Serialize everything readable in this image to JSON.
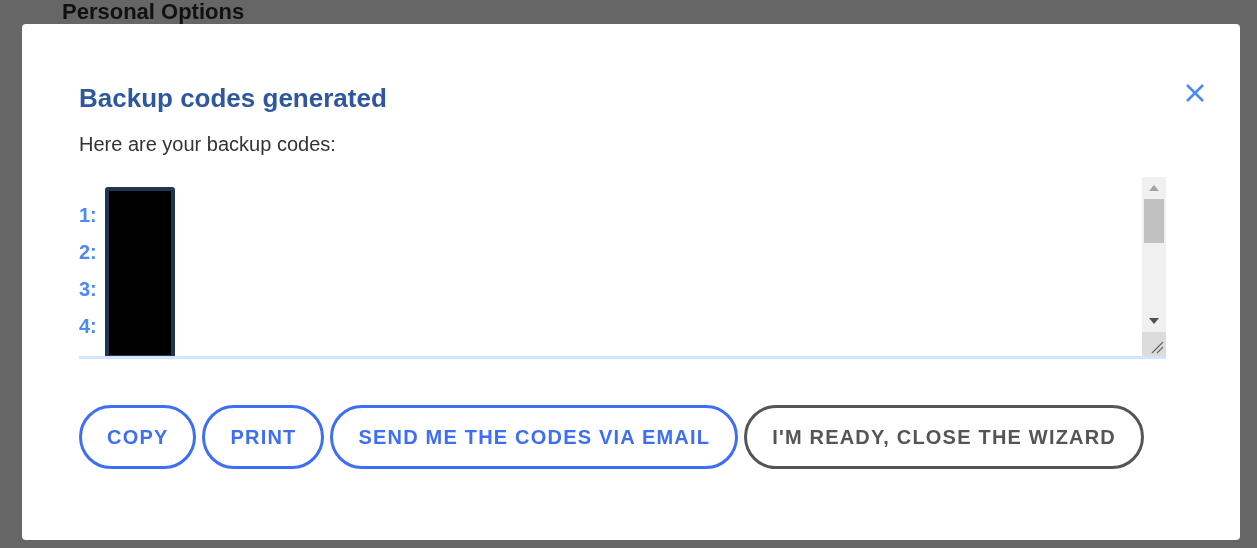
{
  "page": {
    "heading": "Personal Options"
  },
  "dialog": {
    "title": "Backup codes generated",
    "intro": "Here are your backup codes:",
    "codes": [
      {
        "label": "1:"
      },
      {
        "label": "2:"
      },
      {
        "label": "3:"
      },
      {
        "label": "4:"
      }
    ],
    "buttons": [
      {
        "label": "COPY",
        "kind": "primary"
      },
      {
        "label": "PRINT",
        "kind": "primary"
      },
      {
        "label": "SEND ME THE CODES VIA EMAIL",
        "kind": "primary"
      },
      {
        "label": "I'M READY, CLOSE THE WIZARD",
        "kind": "secondary"
      }
    ]
  }
}
